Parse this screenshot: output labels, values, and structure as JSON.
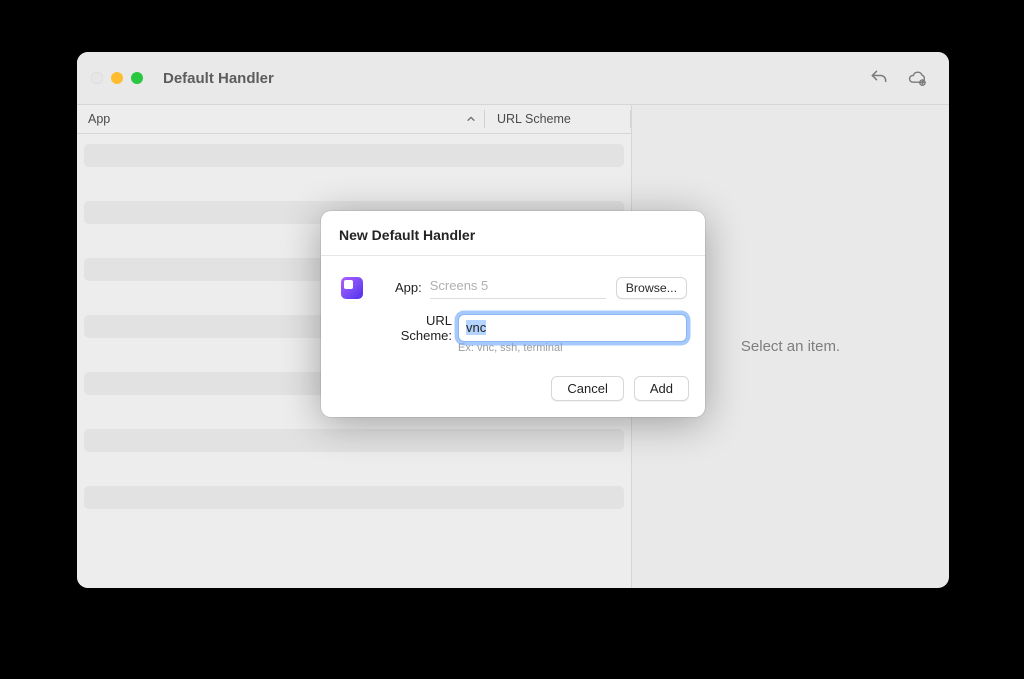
{
  "window": {
    "title": "Default Handler"
  },
  "table": {
    "columns": {
      "app": "App",
      "url_scheme": "URL Scheme"
    }
  },
  "right_pane": {
    "placeholder": "Select an item."
  },
  "dialog": {
    "title": "New Default Handler",
    "app_label": "App:",
    "app_value": "Screens 5",
    "browse_label": "Browse...",
    "url_label": "URL Scheme:",
    "url_value": "vnc",
    "url_hint": "Ex: vnc, ssh, terminal",
    "cancel_label": "Cancel",
    "add_label": "Add"
  },
  "icons": {
    "undo": "undo-icon",
    "cloud_add": "cloud-add-icon"
  }
}
